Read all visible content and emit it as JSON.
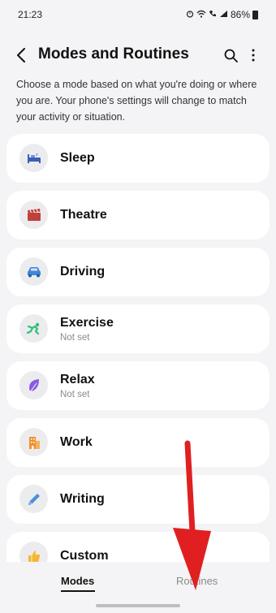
{
  "status_bar": {
    "time": "21:23",
    "battery_percent": "86%",
    "icons": [
      "alarm-icon",
      "wifi-icon",
      "call-icon",
      "signal-icon",
      "battery-icon"
    ]
  },
  "header": {
    "title": "Modes and Routines"
  },
  "description": "Choose a mode based on what you're doing or where you are. Your phone's settings will change to match your activity or situation.",
  "modes": [
    {
      "label": "Sleep",
      "sub": "",
      "icon": "sleep-icon",
      "color": "#3a5fb5"
    },
    {
      "label": "Theatre",
      "sub": "",
      "icon": "theatre-icon",
      "color": "#c0413b"
    },
    {
      "label": "Driving",
      "sub": "",
      "icon": "car-icon",
      "color": "#3e86d6"
    },
    {
      "label": "Exercise",
      "sub": "Not set",
      "icon": "exercise-icon",
      "color": "#2fbf7a"
    },
    {
      "label": "Relax",
      "sub": "Not set",
      "icon": "leaf-icon",
      "color": "#8a5ae0"
    },
    {
      "label": "Work",
      "sub": "",
      "icon": "work-icon",
      "color": "#f0922b"
    },
    {
      "label": "Writing",
      "sub": "",
      "icon": "pen-icon",
      "color": "#4a8fe0"
    },
    {
      "label": "Custom",
      "sub": "",
      "icon": "thumbs-up-icon",
      "color": "#f5b72f"
    }
  ],
  "tabs": {
    "modes": "Modes",
    "routines": "Routines"
  },
  "annotation_color": "#e02020"
}
